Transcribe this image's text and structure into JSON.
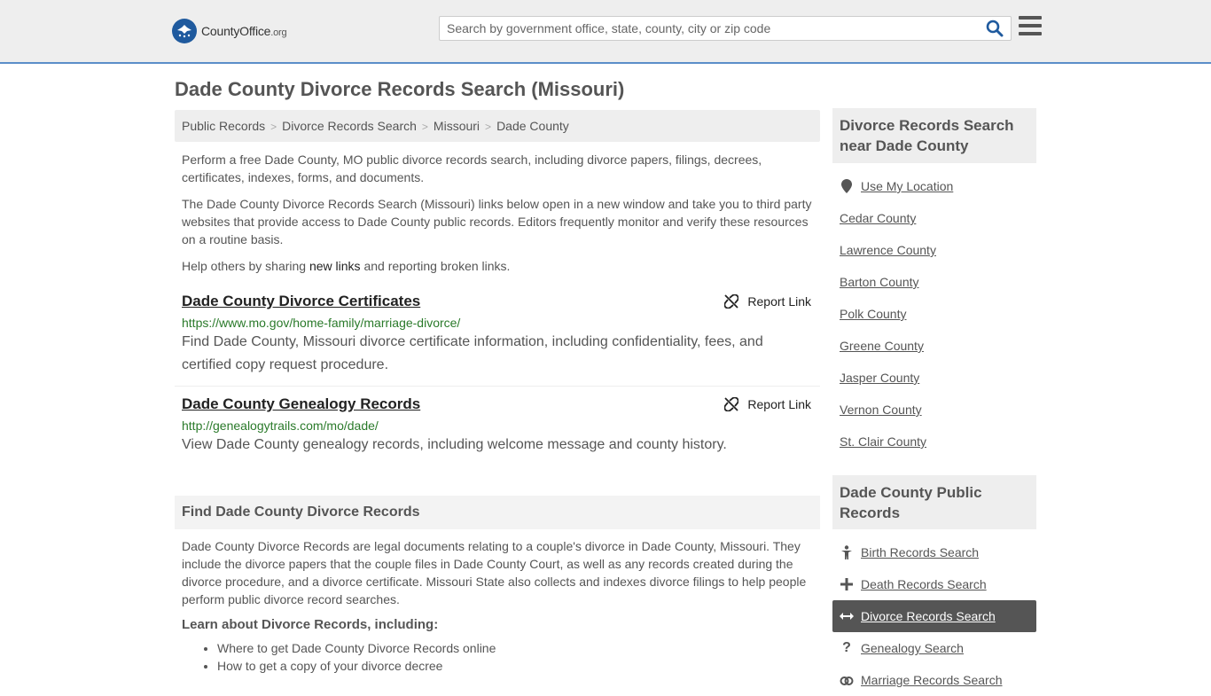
{
  "header": {
    "logo": {
      "brand": "CountyOffice",
      "tld": ".org"
    },
    "search": {
      "placeholder": "Search by government office, state, county, city or zip code"
    }
  },
  "page": {
    "title": "Dade County Divorce Records Search (Missouri)",
    "breadcrumb": [
      "Public Records",
      "Divorce Records Search",
      "Missouri",
      "Dade County"
    ],
    "intro": [
      "Perform a free Dade County, MO public divorce records search, including divorce papers, filings, decrees, certificates, indexes, forms, and documents.",
      "The Dade County Divorce Records Search (Missouri) links below open in a new window and take you to third party websites that provide access to Dade County public records. Editors frequently monitor and verify these resources on a routine basis."
    ],
    "help": {
      "before": "Help others by sharing ",
      "link": "new links",
      "after": " and reporting broken links."
    },
    "report_label": "Report Link",
    "results": [
      {
        "title": "Dade County Divorce Certificates",
        "url": "https://www.mo.gov/home-family/marriage-divorce/",
        "desc": "Find Dade County, Missouri divorce certificate information, including confidentiality, fees, and certified copy request procedure."
      },
      {
        "title": "Dade County Genealogy Records",
        "url": "http://genealogytrails.com/mo/dade/",
        "desc": "View Dade County genealogy records, including welcome message and county history."
      }
    ],
    "find_section": {
      "title": "Find Dade County Divorce Records",
      "body": "Dade County Divorce Records are legal documents relating to a couple's divorce in Dade County, Missouri. They include the divorce papers that the couple files in Dade County Court, as well as any records created during the divorce procedure, and a divorce certificate. Missouri State also collects and indexes divorce filings to help people perform public divorce record searches.",
      "learn_title": "Learn about Divorce Records, including:",
      "learn_items": [
        "Where to get Dade County Divorce Records online",
        "How to get a copy of your divorce decree"
      ]
    }
  },
  "sidebar": {
    "nearby_title": "Divorce Records Search near Dade County",
    "location_label": "Use My Location",
    "nearby": [
      "Cedar County",
      "Lawrence County",
      "Barton County",
      "Polk County",
      "Greene County",
      "Jasper County",
      "Vernon County",
      "St. Clair County"
    ],
    "public_title": "Dade County Public Records",
    "public_links": [
      {
        "label": "Birth Records Search",
        "icon": "person-icon",
        "active": false
      },
      {
        "label": "Death Records Search",
        "icon": "plus-icon",
        "active": false
      },
      {
        "label": "Divorce Records Search",
        "icon": "double-arrow-icon",
        "active": true
      },
      {
        "label": "Genealogy Search",
        "icon": "question-icon",
        "active": false
      },
      {
        "label": "Marriage Records Search",
        "icon": "rings-icon",
        "active": false
      }
    ]
  },
  "colors": {
    "header_bg": "#eeeeee",
    "header_border": "#5b8ec9",
    "logo_blue": "#1f5a9e",
    "url_green": "#2a7a2a",
    "active_bg": "#555555",
    "search_icon": "#1f5a9e"
  }
}
